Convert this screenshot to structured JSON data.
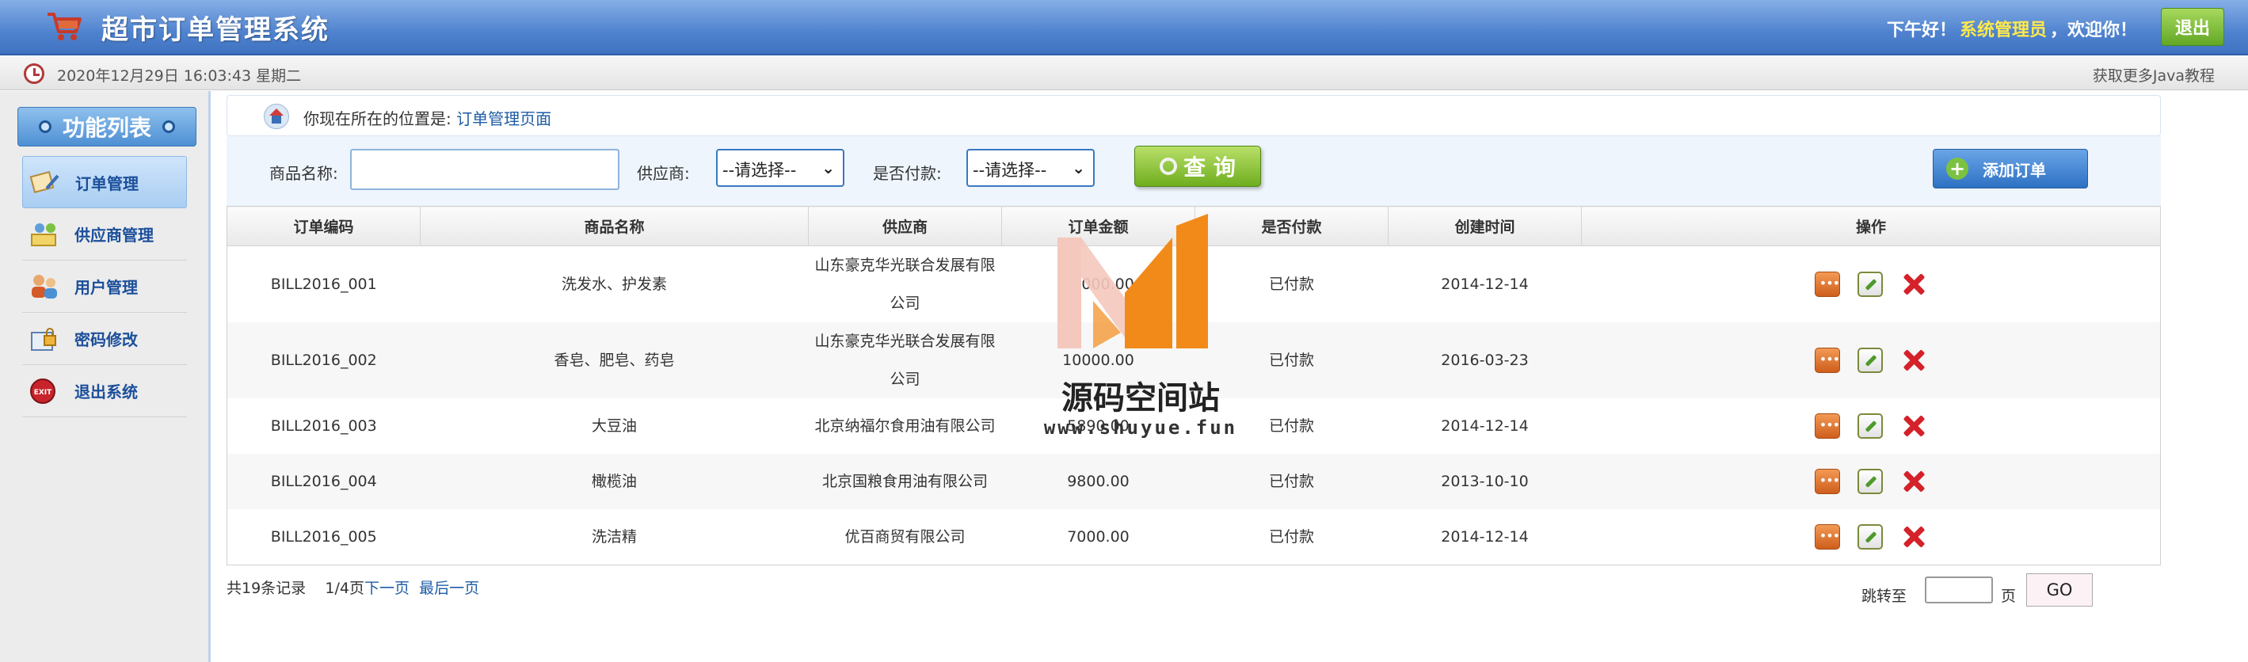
{
  "header": {
    "title": "超市订单管理系统",
    "greeting": "下午好！",
    "username": "系统管理员",
    "welcome": "，欢迎你！",
    "logout_label": "退出",
    "cart_icon": "shopping-cart-icon"
  },
  "datebar": {
    "datetime": "2020年12月29日 16:03:43 星期二",
    "more_link": "获取更多Java教程"
  },
  "sidebar": {
    "title": "功能列表",
    "items": [
      {
        "label": "订单管理",
        "icon": "order-icon",
        "active": true
      },
      {
        "label": "供应商管理",
        "icon": "supplier-icon"
      },
      {
        "label": "用户管理",
        "icon": "users-icon"
      },
      {
        "label": "密码修改",
        "icon": "password-icon"
      },
      {
        "label": "退出系统",
        "icon": "exit-icon"
      }
    ]
  },
  "location": {
    "prefix": "你现在所在的位置是:",
    "page": "订单管理页面"
  },
  "search": {
    "product_label": "商品名称:",
    "product_value": "",
    "supplier_label": "供应商:",
    "supplier_value": "--请选择--",
    "paid_label": "是否付款:",
    "paid_value": "--请选择--",
    "query_label": "查 询",
    "add_label": "添加订单"
  },
  "table": {
    "headers": [
      "订单编码",
      "商品名称",
      "供应商",
      "订单金额",
      "是否付款",
      "创建时间",
      "操作"
    ],
    "rows": [
      {
        "code": "BILL2016_001",
        "product": "洗发水、护发素",
        "supplier": "山东豪克华光联合发展有限公司",
        "amount": "25000.00",
        "paid": "已付款",
        "created": "2014-12-14"
      },
      {
        "code": "BILL2016_002",
        "product": "香皂、肥皂、药皂",
        "supplier": "山东豪克华光联合发展有限公司",
        "amount": "10000.00",
        "paid": "已付款",
        "created": "2016-03-23"
      },
      {
        "code": "BILL2016_003",
        "product": "大豆油",
        "supplier": "北京纳福尔食用油有限公司",
        "amount": "5890.00",
        "paid": "已付款",
        "created": "2014-12-14"
      },
      {
        "code": "BILL2016_004",
        "product": "橄榄油",
        "supplier": "北京国粮食用油有限公司",
        "amount": "9800.00",
        "paid": "已付款",
        "created": "2013-10-10"
      },
      {
        "code": "BILL2016_005",
        "product": "洗洁精",
        "supplier": "优百商贸有限公司",
        "amount": "7000.00",
        "paid": "已付款",
        "created": "2014-12-14"
      }
    ]
  },
  "pager": {
    "total": "共19条记录",
    "page_info": "1/4页",
    "next": "下一页",
    "last": "最后一页",
    "jump_label": "跳转至",
    "page_unit": "页",
    "go_label": "GO",
    "jump_value": ""
  },
  "watermark": {
    "title": "源码空间站",
    "url": "www.shuyue.fun",
    "colors": {
      "orange": "#f28a1a",
      "pink": "#f4c8bd"
    }
  }
}
